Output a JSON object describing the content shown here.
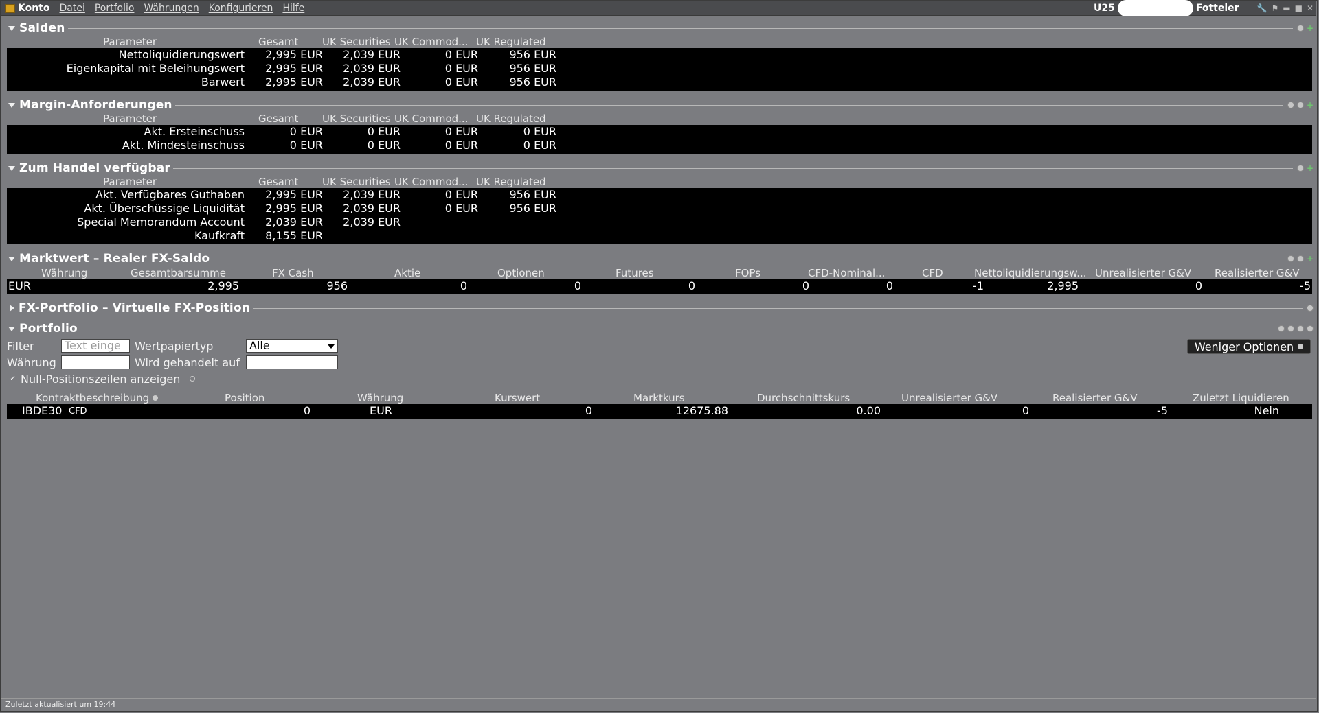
{
  "menubar": {
    "title": "Konto",
    "items": [
      "Datei",
      "Portfolio",
      "Währungen",
      "Konfigurieren",
      "Hilfe"
    ],
    "account_prefix": "U25",
    "account_name": "Fotteler"
  },
  "salden": {
    "title": "Salden",
    "headers": [
      "Parameter",
      "Gesamt",
      "UK Securities",
      "UK Commod...",
      "UK Regulated"
    ],
    "rows": [
      [
        "Nettoliquidierungswert",
        "2,995 EUR",
        "2,039 EUR",
        "0 EUR",
        "956 EUR"
      ],
      [
        "Eigenkapital mit Beleihungswert",
        "2,995 EUR",
        "2,039 EUR",
        "0 EUR",
        "956 EUR"
      ],
      [
        "Barwert",
        "2,995 EUR",
        "2,039 EUR",
        "0 EUR",
        "956 EUR"
      ]
    ]
  },
  "margin": {
    "title": "Margin-Anforderungen",
    "headers": [
      "Parameter",
      "Gesamt",
      "UK Securities",
      "UK Commod...",
      "UK Regulated"
    ],
    "rows": [
      [
        "Akt. Ersteinschuss",
        "0 EUR",
        "0 EUR",
        "0 EUR",
        "0 EUR"
      ],
      [
        "Akt. Mindesteinschuss",
        "0 EUR",
        "0 EUR",
        "0 EUR",
        "0 EUR"
      ]
    ]
  },
  "handel": {
    "title": "Zum Handel verfügbar",
    "headers": [
      "Parameter",
      "Gesamt",
      "UK Securities",
      "UK Commod...",
      "UK Regulated"
    ],
    "rows": [
      [
        "Akt. Verfügbares Guthaben",
        "2,995 EUR",
        "2,039 EUR",
        "0 EUR",
        "956 EUR"
      ],
      [
        "Akt. Überschüssige Liquidität",
        "2,995 EUR",
        "2,039 EUR",
        "0 EUR",
        "956 EUR"
      ],
      [
        "Special Memorandum Account",
        "2,039 EUR",
        "2,039 EUR",
        "",
        ""
      ],
      [
        "Kaufkraft",
        "8,155 EUR",
        "",
        "",
        ""
      ]
    ]
  },
  "markt": {
    "title": "Marktwert – Realer FX-Saldo",
    "headers": [
      "Währung",
      "Gesamtbarsumme",
      "FX Cash",
      "Aktie",
      "Optionen",
      "Futures",
      "FOPs",
      "CFD-Nominal...",
      "CFD",
      "Nettoliquidierungsw...",
      "Unrealisierter G&V",
      "Realisierter G&V"
    ],
    "row": [
      "EUR",
      "2,995",
      "956",
      "0",
      "0",
      "0",
      "0",
      "0",
      "-1",
      "2,995",
      "0",
      "-5"
    ]
  },
  "fx": {
    "title": "FX-Portfolio – Virtuelle FX-Position"
  },
  "portfolio": {
    "title": "Portfolio",
    "filter_label": "Filter",
    "filter_placeholder": "Text einge",
    "type_label": "Wertpapiertyp",
    "type_value": "Alle",
    "currency_label": "Währung",
    "traded_label": "Wird gehandelt auf",
    "less_options": "Weniger Optionen",
    "null_rows": "Null-Positionszeilen anzeigen",
    "headers": [
      "Kontraktbeschreibung",
      "Position",
      "Währung",
      "Kurswert",
      "Marktkurs",
      "Durchschnittskurs",
      "Unrealisierter G&V",
      "Realisierter G&V",
      "Zuletzt Liquidieren"
    ],
    "row": {
      "symbol": "IBDE30",
      "kind": "CFD",
      "position": "0",
      "currency": "EUR",
      "kurswert": "0",
      "marktkurs": "12675.88",
      "durchschnitt": "0.00",
      "unrealized": "0",
      "realized": "-5",
      "zuletzt": "Nein"
    }
  },
  "status": "Zuletzt aktualisiert um 19:44"
}
